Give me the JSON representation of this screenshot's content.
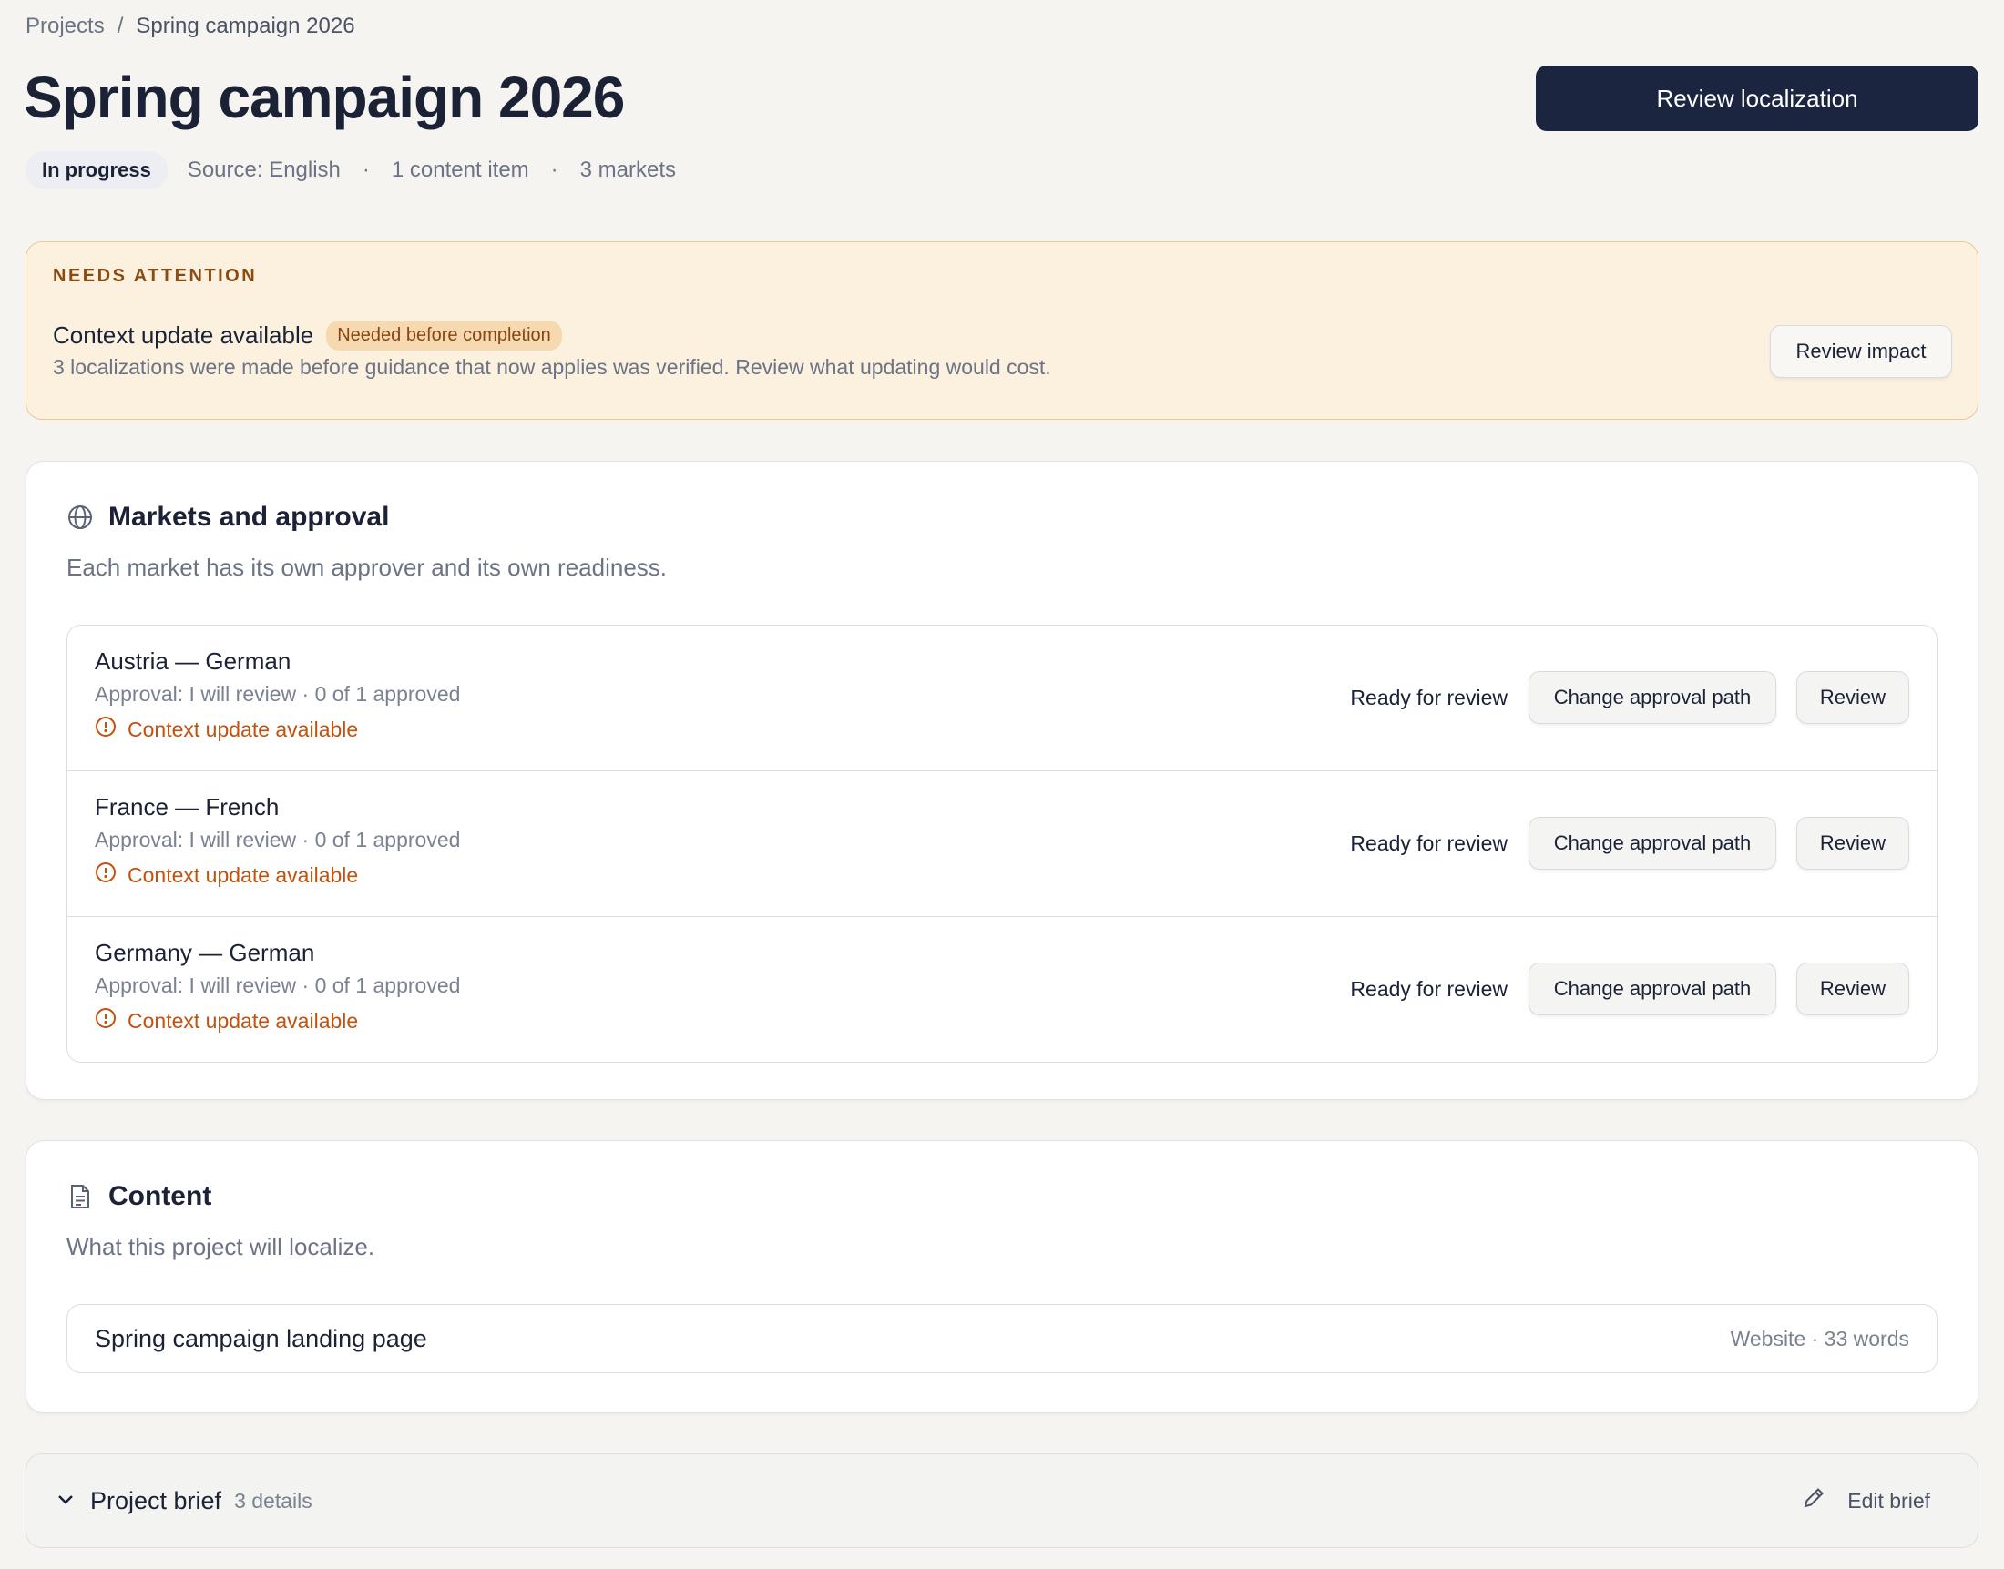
{
  "breadcrumb": {
    "parent": "Projects",
    "separator": "/",
    "current": "Spring campaign 2026"
  },
  "header": {
    "title": "Spring campaign 2026",
    "primary_action": "Review localization",
    "status": "In progress",
    "source": "Source: English",
    "content_count": "1 content item",
    "market_count": "3 markets",
    "dot": "·"
  },
  "attention": {
    "eyebrow": "NEEDS ATTENTION",
    "title": "Context update available",
    "tag": "Needed before completion",
    "description": "3 localizations were made before guidance that now applies was verified. Review what updating would cost.",
    "action": "Review impact"
  },
  "markets": {
    "icon": "globe-icon",
    "title": "Markets and approval",
    "subtitle": "Each market has its own approver and its own readiness.",
    "items": [
      {
        "name": "Austria — German",
        "approval": "Approval: I will review · 0 of 1 approved",
        "alert": "Context update available",
        "status": "Ready for review",
        "change_label": "Change approval path",
        "review_label": "Review"
      },
      {
        "name": "France — French",
        "approval": "Approval: I will review · 0 of 1 approved",
        "alert": "Context update available",
        "status": "Ready for review",
        "change_label": "Change approval path",
        "review_label": "Review"
      },
      {
        "name": "Germany — German",
        "approval": "Approval: I will review · 0 of 1 approved",
        "alert": "Context update available",
        "status": "Ready for review",
        "change_label": "Change approval path",
        "review_label": "Review"
      }
    ]
  },
  "content": {
    "icon": "document-icon",
    "title": "Content",
    "subtitle": "What this project will localize.",
    "items": [
      {
        "title": "Spring campaign landing page",
        "meta": "Website · 33 words"
      }
    ]
  },
  "brief": {
    "title": "Project brief",
    "count": "3 details",
    "edit_label": "Edit brief"
  },
  "colors": {
    "accent_dark": "#1b2540",
    "warning_text": "#c2520d",
    "banner_bg": "#fcf1df",
    "banner_border": "#ecc98f"
  }
}
